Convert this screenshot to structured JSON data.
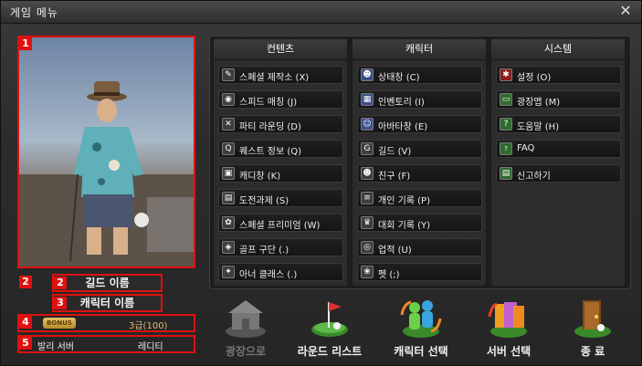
{
  "window": {
    "title": "게임 메뉴"
  },
  "left_panel": {
    "markers": [
      "1",
      "2",
      "3",
      "4",
      "5"
    ],
    "guild_name": "길드 이름",
    "character_name": "캐릭터 이름",
    "bonus_badge": "BONUS",
    "grade": "3급(100)",
    "server": "발리 서버",
    "channel": "레디티"
  },
  "menu": {
    "columns": [
      {
        "header": "컨텐츠",
        "items": [
          {
            "label": "스페셜 제작소 (X)",
            "icon": "wrench-icon"
          },
          {
            "label": "스피드 매칭 (J)",
            "icon": "speed-icon"
          },
          {
            "label": "파티 라운딩 (D)",
            "icon": "clubs-icon"
          },
          {
            "label": "퀘스트 정보 (Q)",
            "icon": "quest-icon"
          },
          {
            "label": "캐디창 (K)",
            "icon": "caddie-icon"
          },
          {
            "label": "도전과제 (S)",
            "icon": "challenge-icon"
          },
          {
            "label": "스페셜 프리미엄 (W)",
            "icon": "premium-icon"
          },
          {
            "label": "골프 구단 (.)",
            "icon": "shield-icon"
          },
          {
            "label": "아너 클래스 (.)",
            "icon": "eagle-icon"
          }
        ]
      },
      {
        "header": "캐릭터",
        "items": [
          {
            "label": "상태창 (C)",
            "icon": "person-icon"
          },
          {
            "label": "인벤토리 (I)",
            "icon": "bag-icon"
          },
          {
            "label": "아바타창 (E)",
            "icon": "avatar-icon"
          },
          {
            "label": "길드 (V)",
            "icon": "guild-icon"
          },
          {
            "label": "친구 (F)",
            "icon": "friends-icon"
          },
          {
            "label": "개인 기록 (P)",
            "icon": "record-icon"
          },
          {
            "label": "대회 기록 (Y)",
            "icon": "trophy-icon"
          },
          {
            "label": "업적 (U)",
            "icon": "medal-icon"
          },
          {
            "label": "펫 (;)",
            "icon": "paw-icon"
          }
        ]
      },
      {
        "header": "시스템",
        "items": [
          {
            "label": "설정 (O)",
            "icon": "gear-icon"
          },
          {
            "label": "광장맵 (M)",
            "icon": "map-icon"
          },
          {
            "label": "도움말 (H)",
            "icon": "help-icon"
          },
          {
            "label": "FAQ",
            "icon": "faq-icon"
          },
          {
            "label": "신고하기",
            "icon": "report-icon"
          }
        ]
      }
    ]
  },
  "bottom_buttons": [
    {
      "label": "광장으로",
      "icon": "plaza-icon",
      "enabled": false
    },
    {
      "label": "라운드 리스트",
      "icon": "golf-flag-icon",
      "enabled": true
    },
    {
      "label": "캐릭터 선택",
      "icon": "character-select-icon",
      "enabled": true
    },
    {
      "label": "서버 선택",
      "icon": "server-select-icon",
      "enabled": true
    },
    {
      "label": "종 료",
      "icon": "exit-door-icon",
      "enabled": true
    }
  ]
}
